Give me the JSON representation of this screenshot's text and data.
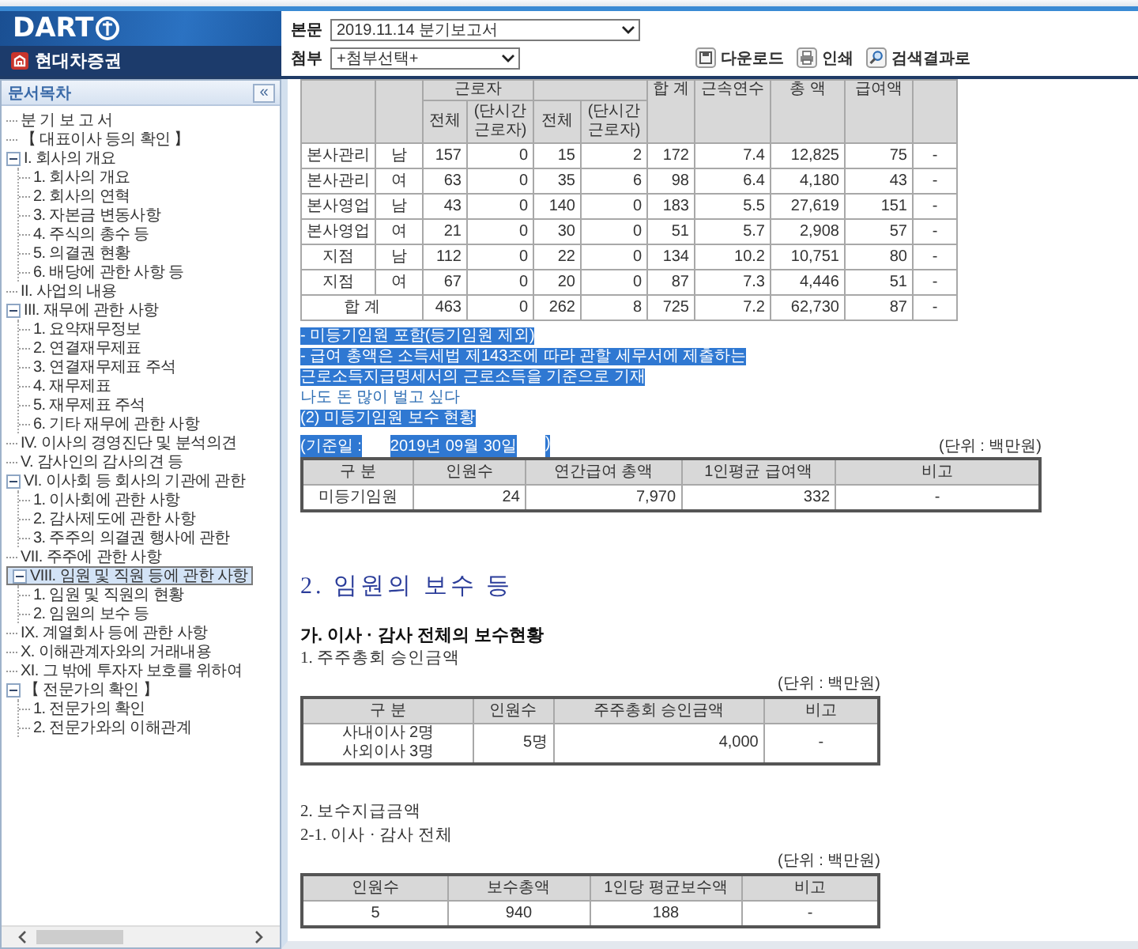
{
  "header": {
    "logo": "DART",
    "company": "현대차증권",
    "document_select": {
      "label": "본문",
      "value": "2019.11.14 분기보고서"
    },
    "attachment_select": {
      "label": "첨부",
      "value": "+첨부선택+"
    },
    "buttons": [
      {
        "kind": "download",
        "label": "다운로드"
      },
      {
        "kind": "print",
        "label": "인쇄"
      },
      {
        "kind": "search",
        "label": "검색결과로"
      }
    ]
  },
  "sidebar": {
    "title": "문서목차",
    "collapse_button": "«",
    "items": [
      {
        "label": "분 기 보 고 서",
        "selected": false
      },
      {
        "label": "【 대표이사 등의 확인 】",
        "selected": false
      },
      {
        "label": "I. 회사의 개요",
        "selected": false,
        "expanded": true,
        "children": [
          {
            "label": "1. 회사의 개요",
            "selected": false
          },
          {
            "label": "2. 회사의 연혁",
            "selected": false
          },
          {
            "label": "3. 자본금 변동사항",
            "selected": false
          },
          {
            "label": "4. 주식의 총수 등",
            "selected": false
          },
          {
            "label": "5. 의결권 현황",
            "selected": false
          },
          {
            "label": "6. 배당에 관한 사항 등",
            "selected": false
          }
        ]
      },
      {
        "label": "II. 사업의 내용",
        "selected": false
      },
      {
        "label": "III. 재무에 관한 사항",
        "selected": false,
        "expanded": true,
        "children": [
          {
            "label": "1. 요약재무정보",
            "selected": false
          },
          {
            "label": "2. 연결재무제표",
            "selected": false
          },
          {
            "label": "3. 연결재무제표 주석",
            "selected": false
          },
          {
            "label": "4. 재무제표",
            "selected": false
          },
          {
            "label": "5. 재무제표 주석",
            "selected": false
          },
          {
            "label": "6. 기타 재무에 관한 사항",
            "selected": false
          }
        ]
      },
      {
        "label": "IV. 이사의 경영진단 및 분석의견",
        "selected": false
      },
      {
        "label": "V. 감사인의 감사의견 등",
        "selected": false
      },
      {
        "label": "VI. 이사회 등 회사의 기관에 관한",
        "selected": false,
        "expanded": true,
        "children": [
          {
            "label": "1. 이사회에 관한 사항",
            "selected": false
          },
          {
            "label": "2. 감사제도에 관한 사항",
            "selected": false
          },
          {
            "label": "3. 주주의 의결권 행사에 관한",
            "selected": false
          }
        ]
      },
      {
        "label": "VII. 주주에 관한 사항",
        "selected": false
      },
      {
        "label": "VIII. 임원 및 직원 등에 관한 사항",
        "selected": true,
        "expanded": true,
        "children": [
          {
            "label": "1. 임원 및 직원의 현황",
            "selected": false
          },
          {
            "label": "2. 임원의 보수 등",
            "selected": false
          }
        ]
      },
      {
        "label": "IX. 계열회사 등에 관한 사항",
        "selected": false
      },
      {
        "label": "X. 이해관계자와의 거래내용",
        "selected": false
      },
      {
        "label": "XI. 그 밖에 투자자 보호를 위하여",
        "selected": false
      },
      {
        "label": "【 전문가의 확인 】",
        "selected": false,
        "expanded": true,
        "children": [
          {
            "label": "1. 전문가의 확인",
            "selected": false
          },
          {
            "label": "2. 전문가와의 이해관계",
            "selected": false
          }
        ]
      }
    ]
  },
  "content": {
    "workforce_table": {
      "header": [
        {
          "kind": "plain"
        },
        {
          "kind": "plain"
        },
        {
          "kind": "group",
          "label": "근로자",
          "sub": [
            "전체",
            "(단시간근로자)"
          ]
        },
        {
          "kind": "group",
          "sub": [
            "전체",
            "(단시간근로자)"
          ]
        },
        {
          "kind": "plain",
          "label": "합 계"
        },
        {
          "kind": "plain",
          "label": "근속연수"
        },
        {
          "kind": "plain",
          "label": "총 액"
        },
        {
          "kind": "plain",
          "label": "급여액"
        },
        {
          "kind": "plain"
        }
      ],
      "rows": [
        [
          "본사관리",
          "남",
          "157",
          "0",
          "15",
          "2",
          "172",
          "7.4",
          "12,825",
          "75",
          "-"
        ],
        [
          "본사관리",
          "여",
          "63",
          "0",
          "35",
          "6",
          "98",
          "6.4",
          "4,180",
          "43",
          "-"
        ],
        [
          "본사영업",
          "남",
          "43",
          "0",
          "140",
          "0",
          "183",
          "5.5",
          "27,619",
          "151",
          "-"
        ],
        [
          "본사영업",
          "여",
          "21",
          "0",
          "30",
          "0",
          "51",
          "5.7",
          "2,908",
          "57",
          "-"
        ],
        [
          "지점",
          "남",
          "112",
          "0",
          "22",
          "0",
          "134",
          "10.2",
          "10,751",
          "80",
          "-"
        ],
        [
          "지점",
          "여",
          "67",
          "0",
          "20",
          "0",
          "87",
          "7.3",
          "4,446",
          "51",
          "-"
        ]
      ],
      "total": {
        "label": "합 계",
        "cells": [
          "463",
          "0",
          "262",
          "8",
          "725",
          "7.2",
          "62,730",
          "87",
          "-"
        ]
      }
    },
    "notes": [
      {
        "text": "- 미등기임원 포함(등기임원 제외)",
        "highlighted": true
      },
      {
        "text": "- 급여 총액은 소득세법 제143조에 따라 관할 세무서에 제출하는",
        "highlighted": true
      },
      {
        "text": "근로소득지급명세서의 근로소득을 기준으로 기재",
        "highlighted": true
      },
      {
        "text": "나도 돈 많이 벌고 싶다",
        "highlighted": false
      }
    ],
    "subsection": {
      "title": "(2) 미등기임원 보수 현황",
      "highlighted": true
    },
    "base_date": {
      "parts": [
        {
          "text": "(기준일 :",
          "highlighted": true
        },
        {
          "text": "2019년 09월 30일",
          "highlighted": true
        },
        {
          "text": ")",
          "highlighted": true
        }
      ],
      "unit": "(단위 : 백만원)"
    },
    "unregistered_table": {
      "columns": [
        "구 분",
        "인원수",
        "연간급여 총액",
        "1인평균 급여액",
        "비고"
      ],
      "rows": [
        [
          "미등기임원",
          "24",
          "7,970",
          "332",
          "-"
        ]
      ]
    },
    "section_heading": "2. 임원의 보수 등",
    "subheading": "가. 이사 · 감사 전체의 보수현황",
    "approval": {
      "title": "1. 주주총회 승인금액",
      "unit": "(단위 : 백만원)",
      "columns": [
        "구 분",
        "인원수",
        "주주총회 승인금액",
        "비고"
      ],
      "rows": [
        [
          "사내이사 2명\n사외이사 3명",
          "5명",
          "4,000",
          "-"
        ]
      ]
    },
    "payment": {
      "title": "2. 보수지급금액",
      "subtitle": "2-1. 이사 · 감사 전체",
      "unit": "(단위 : 백만원)",
      "columns": [
        "인원수",
        "보수총액",
        "1인당 평균보수액",
        "비고"
      ],
      "rows": [
        [
          "5",
          "940",
          "188",
          "-"
        ]
      ]
    }
  }
}
